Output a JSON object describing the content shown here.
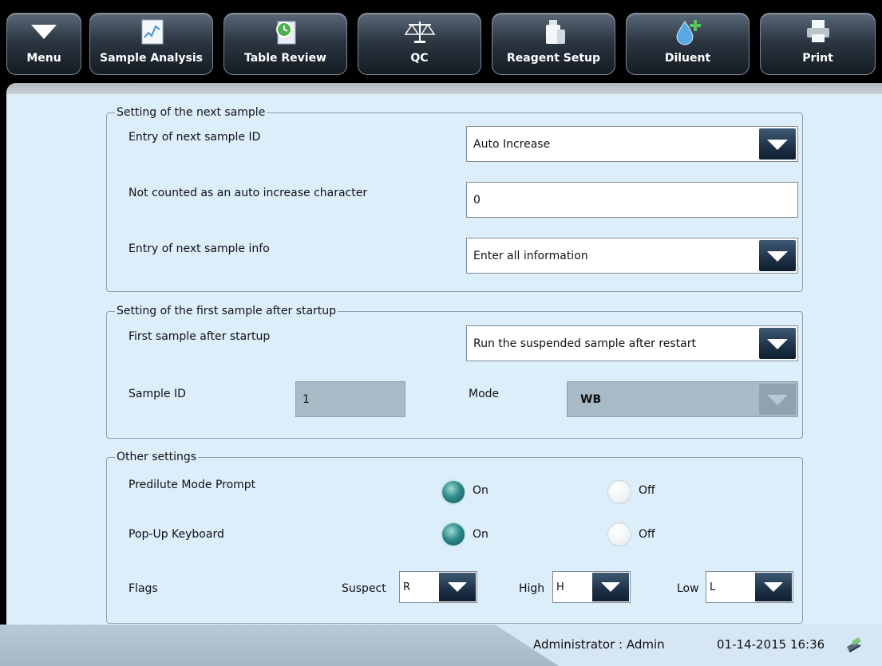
{
  "toolbar": {
    "buttons": [
      {
        "label": "Menu",
        "icon": "chevron-down-icon"
      },
      {
        "label": "Sample Analysis",
        "icon": "sample-analysis-icon"
      },
      {
        "label": "Table Review",
        "icon": "table-review-icon"
      },
      {
        "label": "QC",
        "icon": "balance-scale-icon"
      },
      {
        "label": "Reagent Setup",
        "icon": "reagent-bottle-icon"
      },
      {
        "label": "Diluent",
        "icon": "diluent-drop-icon"
      },
      {
        "label": "Print",
        "icon": "printer-icon"
      }
    ]
  },
  "next_sample": {
    "legend": "Setting of the next sample",
    "entry_id_label": "Entry of next sample ID",
    "entry_id_value": "Auto Increase",
    "not_counted_label": "Not counted as an auto increase character",
    "not_counted_value": "0",
    "entry_info_label": "Entry of next sample info",
    "entry_info_value": "Enter all information"
  },
  "first_sample": {
    "legend": "Setting of the first sample after startup",
    "first_label": "First sample after startup",
    "first_value": "Run the suspended sample after restart",
    "sample_id_label": "Sample ID",
    "sample_id_value": "1",
    "mode_label": "Mode",
    "mode_value": "WB"
  },
  "other": {
    "legend": "Other settings",
    "predilute_label": "Predilute Mode Prompt",
    "popup_label": "Pop-Up Keyboard",
    "on_label": "On",
    "off_label": "Off",
    "predilute_selected": "On",
    "popup_selected": "On",
    "flags_label": "Flags",
    "suspect_label": "Suspect",
    "suspect_value": "R",
    "high_label": "High",
    "high_value": "H",
    "low_label": "Low",
    "low_value": "L"
  },
  "status": {
    "user": "Administrator : Admin",
    "datetime": "01-14-2015 16:36"
  },
  "colors": {
    "content_bg": "#ddeefb",
    "accent_dark": "#1d3147",
    "radio_on": "#2f8c8c"
  }
}
